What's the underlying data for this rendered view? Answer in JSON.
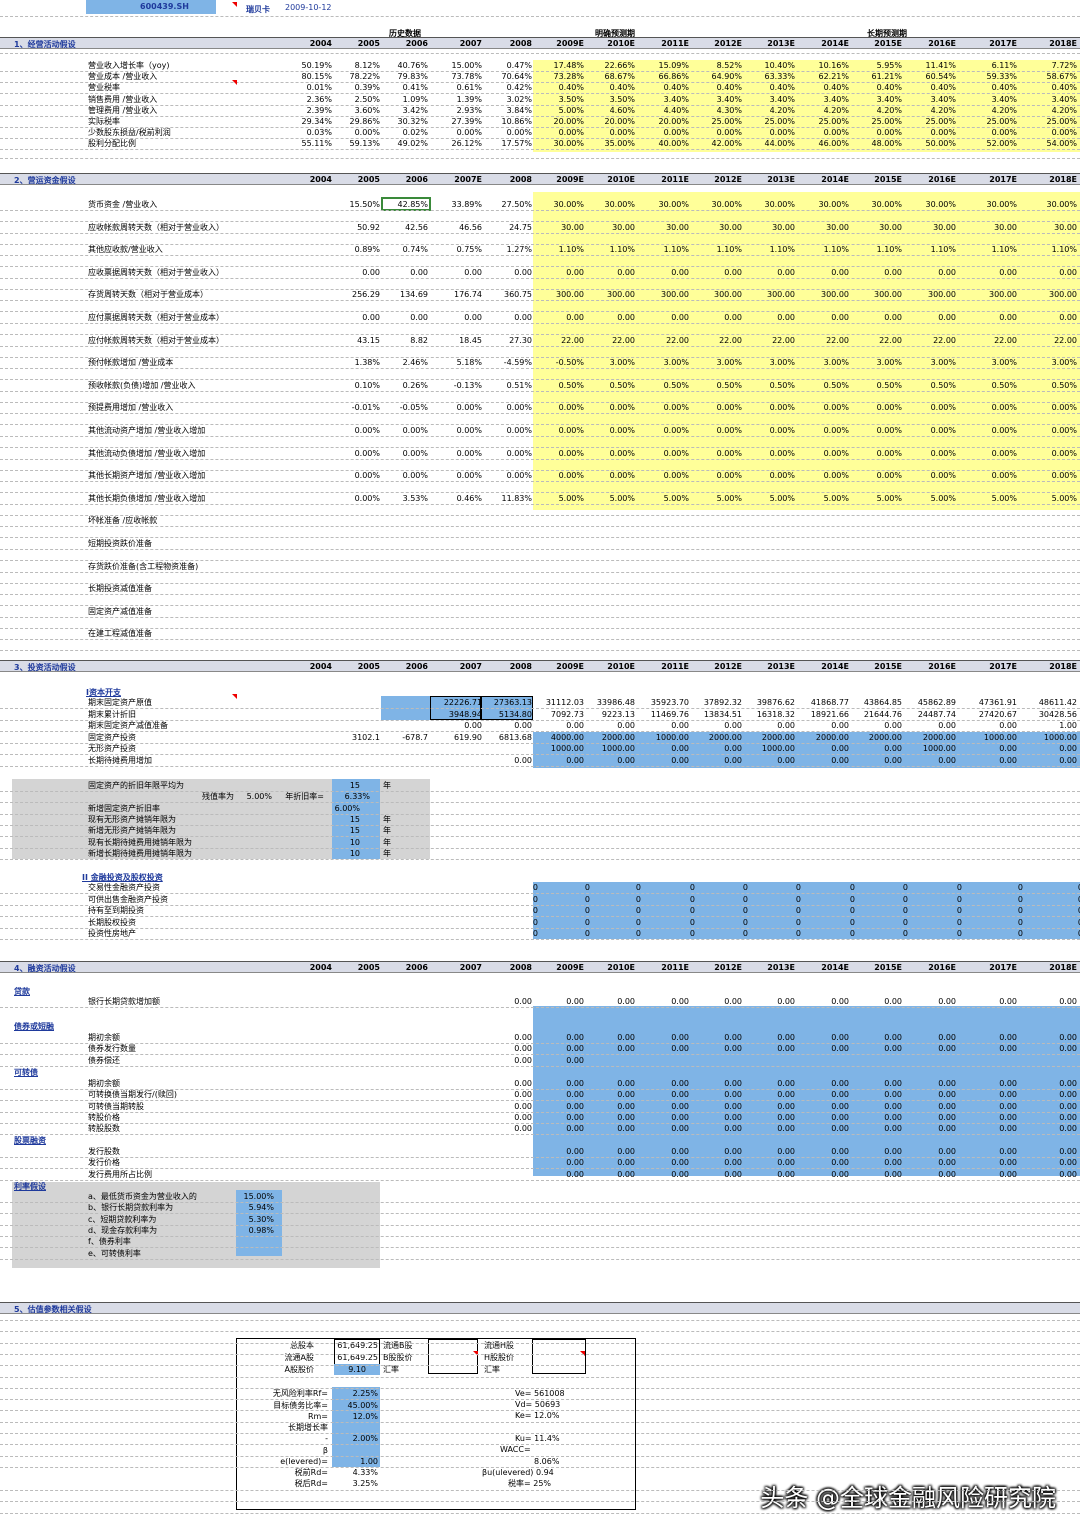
{
  "top": {
    "ticker": "600439.SH",
    "company": "瑞贝卡",
    "date": "2009-10-12"
  },
  "colors": {
    "section_bg": "#d9dce7",
    "title_blue": "#1f3a9c",
    "yellow": "#ffff99",
    "blue": "#7fb4e6",
    "grey": "#d4d4d4"
  },
  "sec1": {
    "title": "1、经营活动假设",
    "hist_label": "历史数据",
    "explicit_label": "明确预测期",
    "long_label": "长期预测期",
    "years": [
      "2004",
      "2005",
      "2006",
      "2007",
      "2008",
      "2009E",
      "2010E",
      "2011E",
      "2012E",
      "2013E",
      "2014E",
      "2015E",
      "2016E",
      "2017E",
      "2018E"
    ],
    "rows": [
      {
        "label": "营业收入增长率（yoy)",
        "v": [
          "50.19%",
          "8.12%",
          "40.76%",
          "15.00%",
          "0.47%",
          "17.48%",
          "22.66%",
          "15.09%",
          "8.52%",
          "10.40%",
          "10.16%",
          "5.95%",
          "11.41%",
          "6.11%",
          "7.72%"
        ]
      },
      {
        "label": "营业成本 /营业收入",
        "v": [
          "80.15%",
          "78.22%",
          "79.83%",
          "73.78%",
          "70.64%",
          "73.28%",
          "68.67%",
          "66.86%",
          "64.90%",
          "63.33%",
          "62.21%",
          "61.21%",
          "60.54%",
          "59.33%",
          "58.67%"
        ]
      },
      {
        "label": "营业税率",
        "v": [
          "0.01%",
          "0.39%",
          "0.41%",
          "0.61%",
          "0.42%",
          "0.40%",
          "0.40%",
          "0.40%",
          "0.40%",
          "0.40%",
          "0.40%",
          "0.40%",
          "0.40%",
          "0.40%",
          "0.40%"
        ]
      },
      {
        "label": "销售费用 /营业收入",
        "v": [
          "2.36%",
          "2.50%",
          "1.09%",
          "1.39%",
          "3.02%",
          "3.50%",
          "3.50%",
          "3.40%",
          "3.40%",
          "3.40%",
          "3.40%",
          "3.40%",
          "3.40%",
          "3.40%",
          "3.40%"
        ]
      },
      {
        "label": "管理费用 /营业收入",
        "v": [
          "2.39%",
          "3.60%",
          "3.42%",
          "2.93%",
          "3.84%",
          "5.00%",
          "4.60%",
          "4.40%",
          "4.30%",
          "4.20%",
          "4.20%",
          "4.20%",
          "4.20%",
          "4.20%",
          "4.20%"
        ]
      },
      {
        "label": "实际税率",
        "v": [
          "29.34%",
          "29.86%",
          "30.32%",
          "27.39%",
          "10.86%",
          "20.00%",
          "20.00%",
          "20.00%",
          "25.00%",
          "25.00%",
          "25.00%",
          "25.00%",
          "25.00%",
          "25.00%",
          "25.00%"
        ]
      },
      {
        "label": "少数股东损益/税前利润",
        "v": [
          "0.03%",
          "0.00%",
          "0.02%",
          "0.00%",
          "0.00%",
          "0.00%",
          "0.00%",
          "0.00%",
          "0.00%",
          "0.00%",
          "0.00%",
          "0.00%",
          "0.00%",
          "0.00%",
          "0.00%"
        ]
      },
      {
        "label": "股利分配比例",
        "v": [
          "55.11%",
          "59.13%",
          "49.02%",
          "26.12%",
          "17.57%",
          "30.00%",
          "35.00%",
          "40.00%",
          "42.00%",
          "44.00%",
          "46.00%",
          "48.00%",
          "50.00%",
          "52.00%",
          "54.00%"
        ]
      }
    ]
  },
  "sec2": {
    "title": "2、营运资金假设",
    "years": [
      "2004",
      "2005",
      "2006",
      "2007E",
      "2008",
      "2009E",
      "2010E",
      "2011E",
      "2012E",
      "2013E",
      "2014E",
      "2015E",
      "2016E",
      "2017E",
      "2018E"
    ],
    "rows": [
      {
        "label": "货币资金 /营业收入",
        "v": [
          "",
          "15.50%",
          "42.85%",
          "33.89%",
          "27.50%",
          "30.00%",
          "30.00%",
          "30.00%",
          "30.00%",
          "30.00%",
          "30.00%",
          "30.00%",
          "30.00%",
          "30.00%",
          "30.00%"
        ]
      },
      {
        "label": "应收帐款周转天数（相对于营业收入）",
        "v": [
          "",
          "50.92",
          "42.56",
          "46.56",
          "24.75",
          "30.00",
          "30.00",
          "30.00",
          "30.00",
          "30.00",
          "30.00",
          "30.00",
          "30.00",
          "30.00",
          "30.00"
        ]
      },
      {
        "label": "其他应收款/营业收入",
        "v": [
          "",
          "0.89%",
          "0.74%",
          "0.75%",
          "1.27%",
          "1.10%",
          "1.10%",
          "1.10%",
          "1.10%",
          "1.10%",
          "1.10%",
          "1.10%",
          "1.10%",
          "1.10%",
          "1.10%"
        ]
      },
      {
        "label": "应收票据周转天数（相对于营业收入）",
        "v": [
          "",
          "0.00",
          "0.00",
          "0.00",
          "0.00",
          "0.00",
          "0.00",
          "0.00",
          "0.00",
          "0.00",
          "0.00",
          "0.00",
          "0.00",
          "0.00",
          "0.00"
        ]
      },
      {
        "label": "存货周转天数（相对于营业成本）",
        "v": [
          "",
          "256.29",
          "134.69",
          "176.74",
          "360.75",
          "300.00",
          "300.00",
          "300.00",
          "300.00",
          "300.00",
          "300.00",
          "300.00",
          "300.00",
          "300.00",
          "300.00"
        ]
      },
      {
        "label": "应付票据周转天数（相对于营业成本）",
        "v": [
          "",
          "0.00",
          "0.00",
          "0.00",
          "0.00",
          "0.00",
          "0.00",
          "0.00",
          "0.00",
          "0.00",
          "0.00",
          "0.00",
          "0.00",
          "0.00",
          "0.00"
        ]
      },
      {
        "label": "应付帐款周转天数（相对于营业成本）",
        "v": [
          "",
          "43.15",
          "8.82",
          "18.45",
          "27.30",
          "22.00",
          "22.00",
          "22.00",
          "22.00",
          "22.00",
          "22.00",
          "22.00",
          "22.00",
          "22.00",
          "22.00"
        ]
      },
      {
        "label": "预付帐款增加 /营业成本",
        "v": [
          "",
          "1.38%",
          "2.46%",
          "5.18%",
          "-4.59%",
          "-0.50%",
          "3.00%",
          "3.00%",
          "3.00%",
          "3.00%",
          "3.00%",
          "3.00%",
          "3.00%",
          "3.00%",
          "3.00%"
        ]
      },
      {
        "label": "预收帐款(负债)增加 /营业收入",
        "v": [
          "",
          "0.10%",
          "0.26%",
          "-0.13%",
          "0.51%",
          "0.50%",
          "0.50%",
          "0.50%",
          "0.50%",
          "0.50%",
          "0.50%",
          "0.50%",
          "0.50%",
          "0.50%",
          "0.50%"
        ]
      },
      {
        "label": "预提费用增加 /营业收入",
        "v": [
          "",
          "-0.01%",
          "-0.05%",
          "0.00%",
          "0.00%",
          "0.00%",
          "0.00%",
          "0.00%",
          "0.00%",
          "0.00%",
          "0.00%",
          "0.00%",
          "0.00%",
          "0.00%",
          "0.00%"
        ]
      },
      {
        "label": "其他流动资产增加 /营业收入增加",
        "v": [
          "",
          "0.00%",
          "0.00%",
          "0.00%",
          "0.00%",
          "0.00%",
          "0.00%",
          "0.00%",
          "0.00%",
          "0.00%",
          "0.00%",
          "0.00%",
          "0.00%",
          "0.00%",
          "0.00%"
        ]
      },
      {
        "label": "其他流动负债增加 /营业收入增加",
        "v": [
          "",
          "0.00%",
          "0.00%",
          "0.00%",
          "0.00%",
          "0.00%",
          "0.00%",
          "0.00%",
          "0.00%",
          "0.00%",
          "0.00%",
          "0.00%",
          "0.00%",
          "0.00%",
          "0.00%"
        ]
      },
      {
        "label": "其他长期资产增加 /营业收入增加",
        "v": [
          "",
          "0.00%",
          "0.00%",
          "0.00%",
          "0.00%",
          "0.00%",
          "0.00%",
          "0.00%",
          "0.00%",
          "0.00%",
          "0.00%",
          "0.00%",
          "0.00%",
          "0.00%",
          "0.00%"
        ]
      },
      {
        "label": "其他长期负债增加 /营业收入增加",
        "v": [
          "",
          "0.00%",
          "3.53%",
          "0.46%",
          "11.83%",
          "5.00%",
          "5.00%",
          "5.00%",
          "5.00%",
          "5.00%",
          "5.00%",
          "5.00%",
          "5.00%",
          "5.00%",
          "5.00%"
        ]
      },
      {
        "label": "坏帐准备 /应收帐款",
        "v": []
      },
      {
        "label": "短期投资跌价准备",
        "v": []
      },
      {
        "label": "存货跌价准备(含工程物资准备)",
        "v": []
      },
      {
        "label": "长期投资减值准备",
        "v": []
      },
      {
        "label": "固定资产减值准备",
        "v": []
      },
      {
        "label": "在建工程减值准备",
        "v": []
      }
    ]
  },
  "sec3": {
    "title": "3、投资活动假设",
    "years": [
      "2004",
      "2005",
      "2006",
      "2007",
      "2008",
      "2009E",
      "2010E",
      "2011E",
      "2012E",
      "2013E",
      "2014E",
      "2015E",
      "2016E",
      "2017E",
      "2018E"
    ],
    "capex_title": "I资本开支",
    "capex_rows": [
      {
        "label": "期末固定资产原值",
        "v": [
          "",
          "",
          "",
          "22226.71",
          "27363.13",
          "31112.03",
          "33986.48",
          "35923.70",
          "37892.32",
          "39876.62",
          "41868.77",
          "43864.85",
          "45862.89",
          "47361.91",
          "48611.42"
        ]
      },
      {
        "label": "期末累计折旧",
        "v": [
          "",
          "",
          "",
          "3948.94",
          "5134.80",
          "7092.73",
          "9223.13",
          "11469.76",
          "13834.51",
          "16318.32",
          "18921.66",
          "21644.76",
          "24487.74",
          "27420.67",
          "30428.56"
        ]
      },
      {
        "label": "期末固定资产减值准备",
        "v": [
          "",
          "",
          "",
          "0.00",
          "0.00",
          "0.00",
          "0.00",
          "0.00",
          "0.00",
          "0.00",
          "0.00",
          "0.00",
          "0.00",
          "0.00",
          "1.00"
        ]
      },
      {
        "label": "固定资产投资",
        "v": [
          "",
          "3102.1",
          "-678.7",
          "619.90",
          "6813.68",
          "4000.00",
          "2000.00",
          "1000.00",
          "2000.00",
          "2000.00",
          "2000.00",
          "2000.00",
          "2000.00",
          "1000.00",
          "1000.00"
        ]
      },
      {
        "label": "无形资产投资",
        "v": [
          "",
          "",
          "",
          "",
          "",
          "1000.00",
          "1000.00",
          "0.00",
          "0.00",
          "1000.00",
          "0.00",
          "0.00",
          "1000.00",
          "0.00",
          "0.00"
        ]
      },
      {
        "label": "长期待摊费用增加",
        "v": [
          "",
          "",
          "",
          "",
          "0.00",
          "0.00",
          "0.00",
          "0.00",
          "0.00",
          "0.00",
          "0.00",
          "0.00",
          "0.00",
          "0.00",
          "0.00"
        ]
      }
    ],
    "dep": {
      "r1_label": "固定资产的折旧年限平均为",
      "r1_val": "15",
      "r1_unit": "年",
      "salv_label": "残值率为",
      "salv_val": "5.00%",
      "rate_label": "年折旧率=",
      "rate_val": "6.33%",
      "r3_label": "新增固定资产折旧率",
      "r3_val": "6.00%",
      "r4_label": "现有无形资产摊销年限为",
      "r4_val": "15",
      "r4_unit": "年",
      "r5_label": "新增无形资产摊销年限为",
      "r5_val": "15",
      "r5_unit": "年",
      "r6_label": "现有长期待摊费用摊销年限为",
      "r6_val": "10",
      "r6_unit": "年",
      "r7_label": "新增长期待摊费用摊销年限为",
      "r7_val": "10",
      "r7_unit": "年"
    },
    "fin_title": "II 金融投资及股权投资",
    "fin_rows": [
      "交易性金融资产投资",
      "可供出售金融资产投资",
      "持有至到期投资",
      "长期股权投资",
      "投资性房地产"
    ],
    "fin_val": "0"
  },
  "sec4": {
    "title": "4、融资活动假设",
    "years": [
      "2004",
      "2005",
      "2006",
      "2007",
      "2008",
      "2009E",
      "2010E",
      "2011E",
      "2012E",
      "2013E",
      "2014E",
      "2015E",
      "2016E",
      "2017E",
      "2018E"
    ],
    "loan_title": "贷款",
    "loan_row": "银行长期贷款增加额",
    "bond_title": "债券或短融",
    "bond_rows": [
      "期初余额",
      "债券发行数量",
      "债券偿还"
    ],
    "conv_title": "可转债",
    "conv_rows": [
      "期初余额",
      "可转换债当期发行/(赎回)",
      "可转债当期转股",
      "转股价格",
      "转股股数"
    ],
    "equity_title": "股票融资",
    "equity_rows": [
      "发行股数",
      "发行价格",
      "发行费用所占比例"
    ],
    "zero": "0.00",
    "rate_title": "利率假设",
    "rates": [
      {
        "label": "a、最低货币资金为营业收入的",
        "v": "15.00%"
      },
      {
        "label": "b、银行长期贷款利率为",
        "v": "5.94%"
      },
      {
        "label": "c、短期贷款利率为",
        "v": "5.30%"
      },
      {
        "label": "d、现金存款利率为",
        "v": "0.98%"
      },
      {
        "label": "f、债券利率",
        "v": ""
      },
      {
        "label": "e、可转债利率",
        "v": ""
      }
    ]
  },
  "sec5": {
    "title": "5、估值参数相关假设",
    "total_shares_label": "总股本",
    "total_shares": "61,649.25",
    "b_float_label": "流通B股",
    "h_float_label": "流通H股",
    "a_float_label": "流通A股",
    "a_float": "61,649.25",
    "b_price_label": "B股股价",
    "h_price_label": "H股股价",
    "a_price_label": "A股股价",
    "a_price": "9.10",
    "fx1_label": "汇率",
    "fx2_label": "汇率",
    "rf_label": "无风险利率Rf=",
    "rf": "2.25%",
    "debt_label": "目标债务比率=",
    "debt": "45.00%",
    "rm_label": "Rm=",
    "rm": "12.0%",
    "lg_label": "长期增长率",
    "lg_dash": "-",
    "lg": "2.00%",
    "beta_label": "β",
    "beta_lev_label": "e(levered)=",
    "beta_lev": "1.00",
    "rd_pre_label": "税前Rd=",
    "rd_pre": "4.33%",
    "rd_post_label": "税后Rd=",
    "rd_post": "3.25%",
    "ve": "Ve= 561008",
    "vd": "Vd= 50693",
    "ke": "Ke= 12.0%",
    "ku": "Ku= 11.4%",
    "wacc_label": "WACC=",
    "wacc": "8.06%",
    "bu": "βu(ulevered) 0.94",
    "tax": "税率= 25%"
  },
  "watermark": "头条 @全球金融风险研究院"
}
